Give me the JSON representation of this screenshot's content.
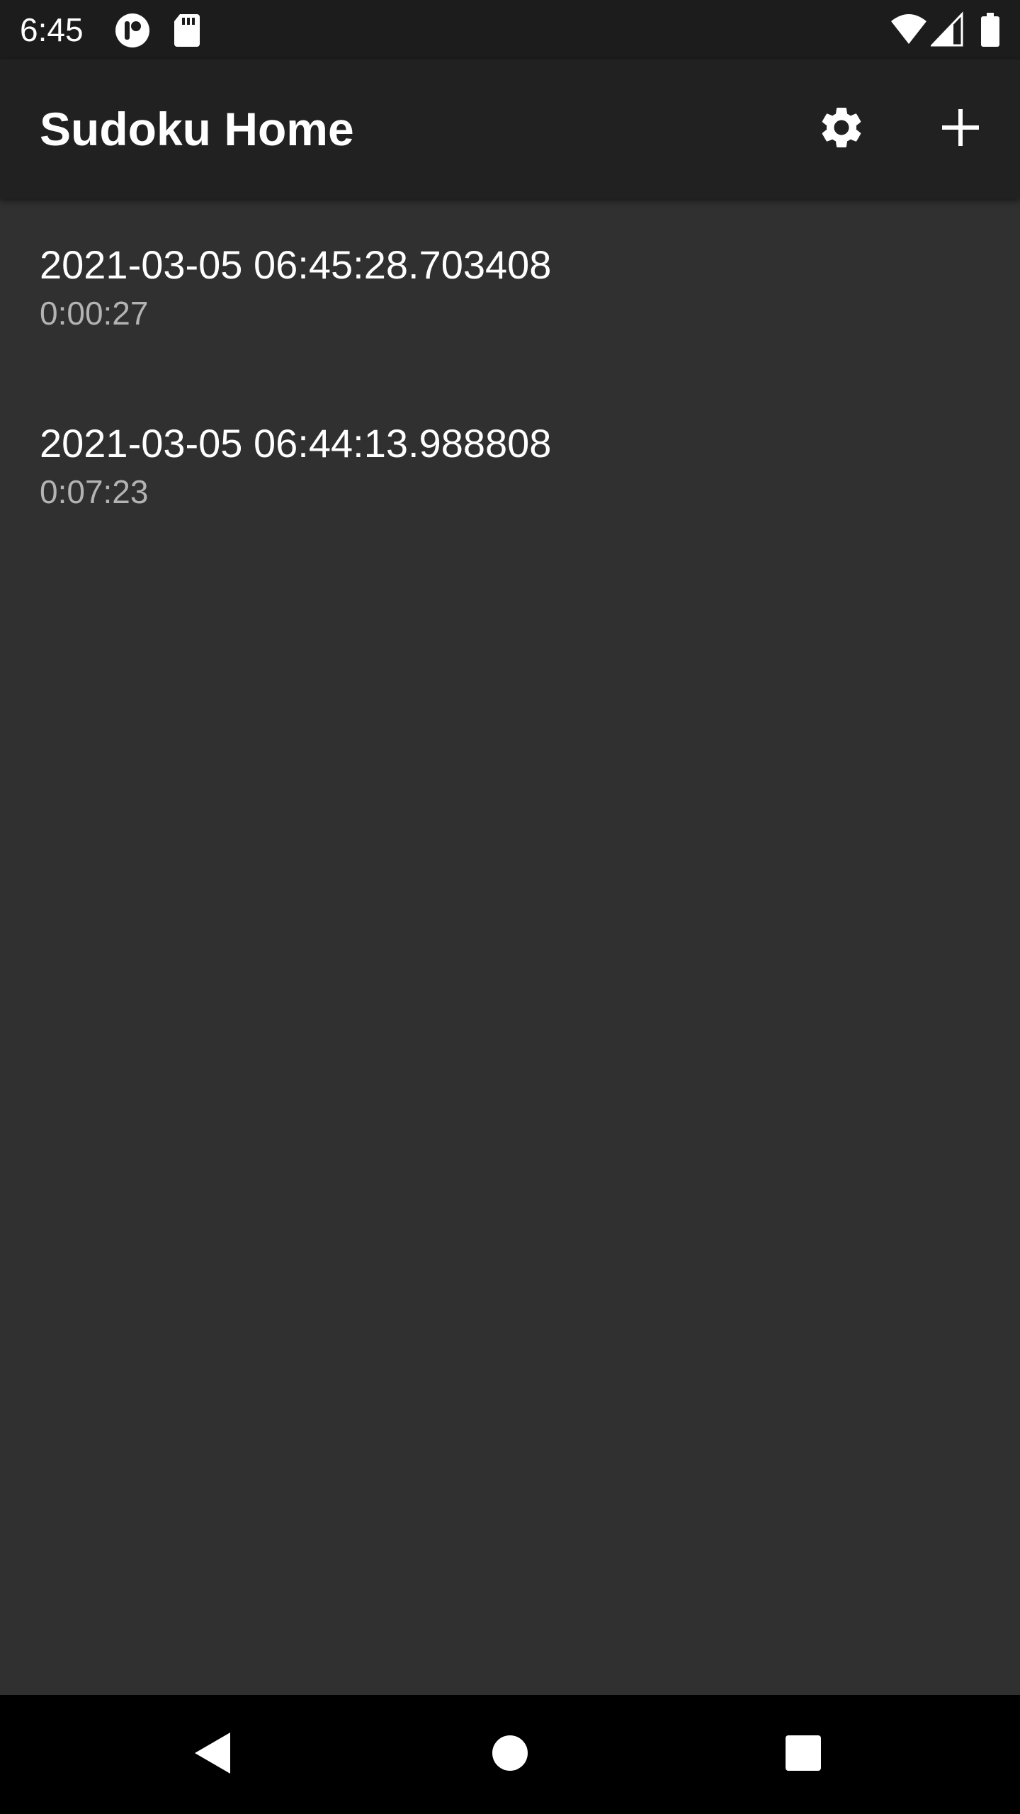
{
  "status_bar": {
    "time": "6:45",
    "left_icons": [
      "app-notification-icon",
      "sd-card-icon"
    ],
    "right_icons": [
      "wifi-icon",
      "cellular-signal-icon",
      "battery-icon"
    ]
  },
  "app_bar": {
    "title": "Sudoku Home",
    "actions": [
      "settings-icon",
      "add-icon"
    ]
  },
  "games": [
    {
      "title": "2021-03-05 06:45:28.703408",
      "subtitle": "0:00:27"
    },
    {
      "title": "2021-03-05 06:44:13.988808",
      "subtitle": "0:07:23"
    }
  ],
  "nav_bar": {
    "buttons": [
      "back-icon",
      "home-icon",
      "recents-icon"
    ]
  },
  "colors": {
    "background": "#303030",
    "app_bar": "#212121",
    "status_bar": "#1c1c1c",
    "nav_bar": "#000000",
    "primary_text": "#ffffff",
    "secondary_text": "#b3b3b3"
  }
}
